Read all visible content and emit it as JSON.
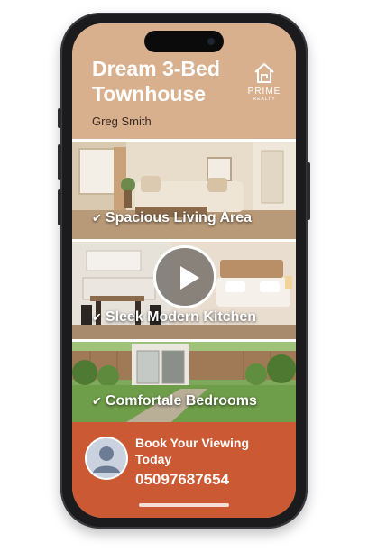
{
  "listing": {
    "title": "Dream 3-Bed Townhouse",
    "agent_name": "Greg Smith"
  },
  "logo": {
    "name": "PRIME",
    "tagline": "REALTY",
    "icon": "house-icon"
  },
  "features": [
    {
      "label": "Spacious Living Area",
      "icon": "checkmark-icon"
    },
    {
      "label": "Sleek Modern Kitchen",
      "icon": "checkmark-icon"
    },
    {
      "label": "Comfortale Bedrooms",
      "icon": "checkmark-icon"
    }
  ],
  "video": {
    "icon": "play-icon"
  },
  "contact": {
    "cta": "Book Your Viewing Today",
    "phone": "05097687654",
    "avatar_icon": "user-avatar-icon"
  },
  "colors": {
    "header_bg": "#d9b08e",
    "footer_bg": "#cb5a34",
    "text_light": "#ffffff",
    "text_dark": "#3a2a22"
  }
}
